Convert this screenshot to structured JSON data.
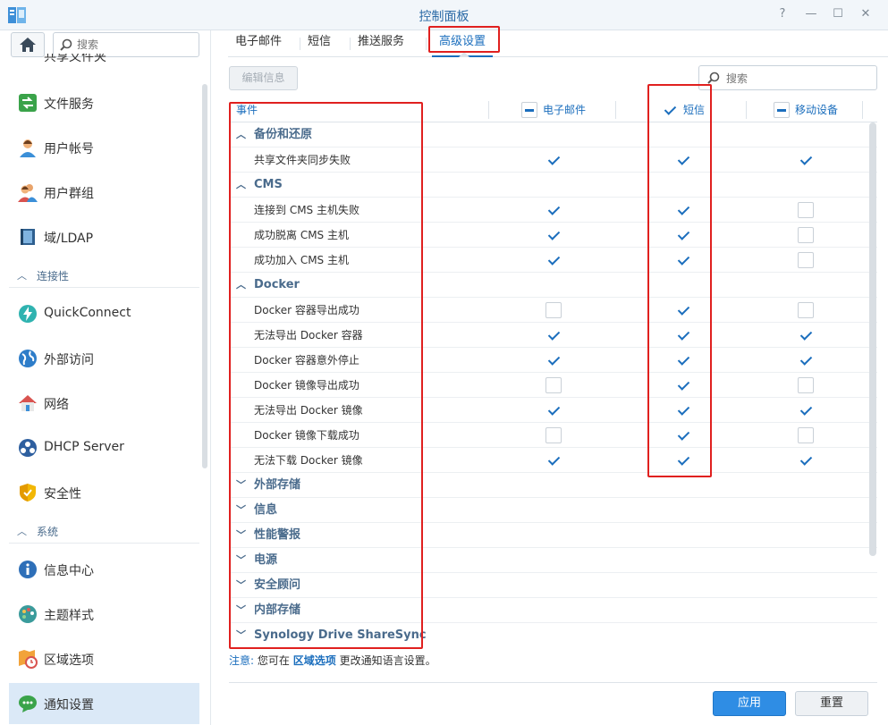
{
  "window": {
    "title": "控制面板",
    "help_label": "?",
    "minimize_label": "—",
    "maximize_label": "☐",
    "close_label": "✕",
    "pin_label": "▭"
  },
  "sidebar": {
    "search_placeholder": "搜索",
    "cut_item": "共享文件夹",
    "items": [
      {
        "label": "文件服务",
        "icon": "file-services-icon"
      },
      {
        "label": "用户帐号",
        "icon": "user-icon"
      },
      {
        "label": "用户群组",
        "icon": "user-group-icon"
      },
      {
        "label": "域/LDAP",
        "icon": "domain-ldap-icon"
      }
    ],
    "section_connectivity": "连接性",
    "connectivity_items": [
      {
        "label": "QuickConnect",
        "icon": "quickconnect-icon"
      },
      {
        "label": "外部访问",
        "icon": "external-access-icon"
      },
      {
        "label": "网络",
        "icon": "network-icon"
      },
      {
        "label": "DHCP Server",
        "icon": "dhcp-server-icon"
      },
      {
        "label": "安全性",
        "icon": "security-icon"
      }
    ],
    "section_system": "系统",
    "system_items": [
      {
        "label": "信息中心",
        "icon": "info-center-icon"
      },
      {
        "label": "主题样式",
        "icon": "theme-icon"
      },
      {
        "label": "区域选项",
        "icon": "regional-options-icon"
      },
      {
        "label": "通知设置",
        "icon": "notification-icon",
        "active": true
      }
    ]
  },
  "tabs": [
    "电子邮件",
    "短信",
    "推送服务",
    "高级设置"
  ],
  "active_tab": "高级设置",
  "toolbar": {
    "edit_label": "编辑信息",
    "search_placeholder": "搜索"
  },
  "grid": {
    "columns": {
      "event": "事件",
      "email": "电子邮件",
      "sms": "短信",
      "mobile": "移动设备"
    },
    "header_states": {
      "email": "partial",
      "sms": "checked",
      "mobile": "partial"
    },
    "rows": [
      {
        "type": "group",
        "label": "备份和还原",
        "expanded": true
      },
      {
        "type": "event",
        "label": "共享文件夹同步失败",
        "email": true,
        "sms": true,
        "mobile": true
      },
      {
        "type": "group",
        "label": "CMS",
        "expanded": true
      },
      {
        "type": "event",
        "label": "连接到 CMS 主机失败",
        "email": true,
        "sms": true,
        "mobile": false
      },
      {
        "type": "event",
        "label": "成功脱离 CMS 主机",
        "email": true,
        "sms": true,
        "mobile": false
      },
      {
        "type": "event",
        "label": "成功加入 CMS 主机",
        "email": true,
        "sms": true,
        "mobile": false
      },
      {
        "type": "group",
        "label": "Docker",
        "expanded": true
      },
      {
        "type": "event",
        "label": "Docker 容器导出成功",
        "email": false,
        "sms": true,
        "mobile": false
      },
      {
        "type": "event",
        "label": "无法导出 Docker 容器",
        "email": true,
        "sms": true,
        "mobile": true
      },
      {
        "type": "event",
        "label": "Docker 容器意外停止",
        "email": true,
        "sms": true,
        "mobile": true
      },
      {
        "type": "event",
        "label": "Docker 镜像导出成功",
        "email": false,
        "sms": true,
        "mobile": false
      },
      {
        "type": "event",
        "label": "无法导出 Docker 镜像",
        "email": true,
        "sms": true,
        "mobile": true
      },
      {
        "type": "event",
        "label": "Docker 镜像下载成功",
        "email": false,
        "sms": true,
        "mobile": false
      },
      {
        "type": "event",
        "label": "无法下载 Docker 镜像",
        "email": true,
        "sms": true,
        "mobile": true
      },
      {
        "type": "group",
        "label": "外部存储",
        "expanded": false
      },
      {
        "type": "group",
        "label": "信息",
        "expanded": false
      },
      {
        "type": "group",
        "label": "性能警报",
        "expanded": false
      },
      {
        "type": "group",
        "label": "电源",
        "expanded": false
      },
      {
        "type": "group",
        "label": "安全顾问",
        "expanded": false
      },
      {
        "type": "group",
        "label": "内部存储",
        "expanded": false
      },
      {
        "type": "group",
        "label": "Synology Drive ShareSync",
        "expanded": false
      }
    ]
  },
  "note": {
    "prefix": "注意:",
    "text1": "您可在",
    "link": "区域选项",
    "text2": "更改通知语言设置。"
  },
  "footer": {
    "apply_label": "应用",
    "reset_label": "重置"
  },
  "colors": {
    "accent": "#1b6ebd",
    "highlight": "#e0201f",
    "apply": "#2f8de4"
  }
}
